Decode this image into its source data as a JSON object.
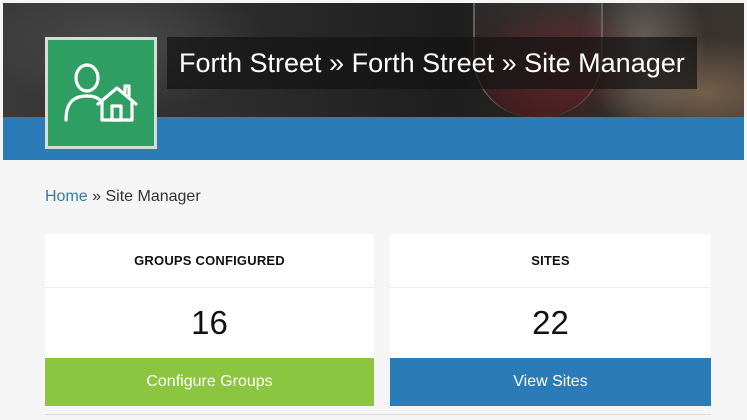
{
  "header": {
    "title": "Forth Street » Forth Street » Site Manager"
  },
  "logo": {
    "icon": "user-house-icon",
    "color": "#2f9e62"
  },
  "breadcrumb": {
    "home": "Home",
    "separator": " » ",
    "current": "Site Manager"
  },
  "cards": {
    "groups": {
      "label": "GROUPS CONFIGURED",
      "value": "16",
      "button": "Configure Groups",
      "button_color": "#8cc53f"
    },
    "sites": {
      "label": "SITES",
      "value": "22",
      "button": "View Sites",
      "button_color": "#2b7bb9"
    }
  },
  "colors": {
    "accent_blue": "#2b7bb9",
    "accent_green": "#8cc53f"
  }
}
